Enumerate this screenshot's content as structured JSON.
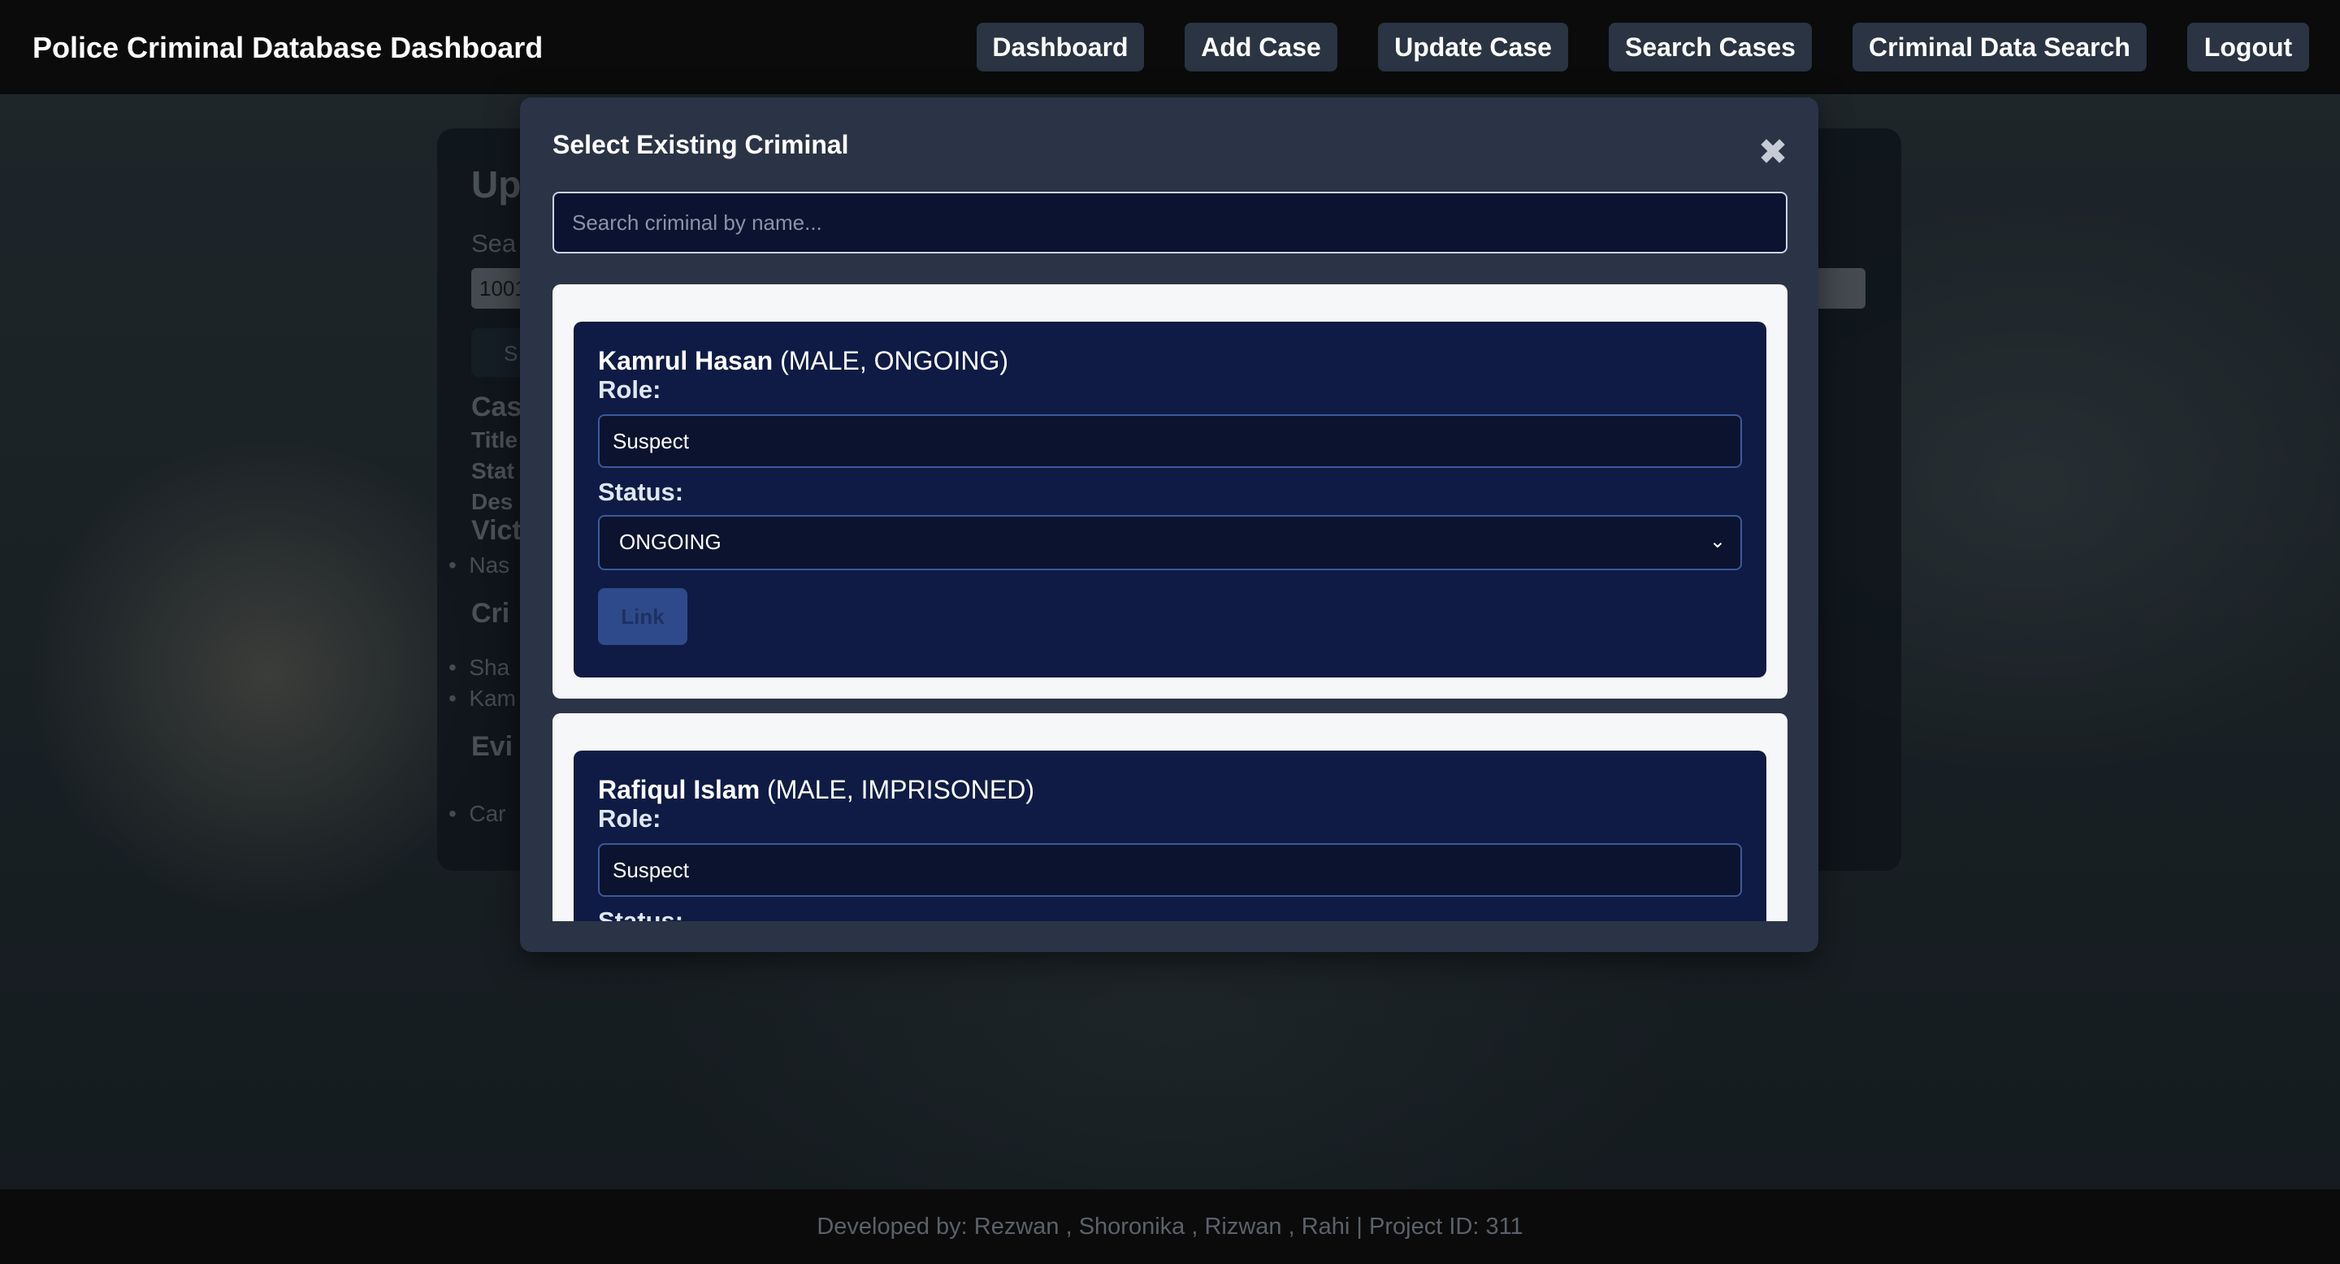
{
  "header": {
    "title": "Police Criminal Database Dashboard",
    "nav": [
      {
        "label": "Dashboard"
      },
      {
        "label": "Add Case"
      },
      {
        "label": "Update Case"
      },
      {
        "label": "Search Cases"
      },
      {
        "label": "Criminal Data Search"
      },
      {
        "label": "Logout"
      }
    ]
  },
  "background_panel": {
    "heading": "Up",
    "search_label": "Sea",
    "case_value": "1001",
    "search_button": "S",
    "case_section": "Cas",
    "title_label": "Title",
    "status_label": "Stat",
    "desc_label": "Des",
    "victims_heading": "Vict",
    "victim_item": "Nas",
    "criminals_heading": "Cri",
    "criminal_items": [
      "Sha",
      "Kam"
    ],
    "evidence_heading": "Evi",
    "evidence_item": "Car"
  },
  "modal": {
    "title": "Select Existing Criminal",
    "close_symbol": "✖",
    "search_placeholder": "Search criminal by name...",
    "criminals": [
      {
        "name": "Kamrul Hasan",
        "meta": "(MALE, ONGOING)",
        "role_label": "Role:",
        "role_value": "Suspect",
        "status_label": "Status:",
        "status_value": "ONGOING",
        "link_label": "Link"
      },
      {
        "name": "Rafiqul Islam",
        "meta": "(MALE, IMPRISONED)",
        "role_label": "Role:",
        "role_value": "Suspect",
        "status_label": "Status:"
      }
    ]
  },
  "footer": {
    "text": "Developed by: Rezwan , Shoronika , Rizwan , Rahi | Project ID: 311"
  }
}
